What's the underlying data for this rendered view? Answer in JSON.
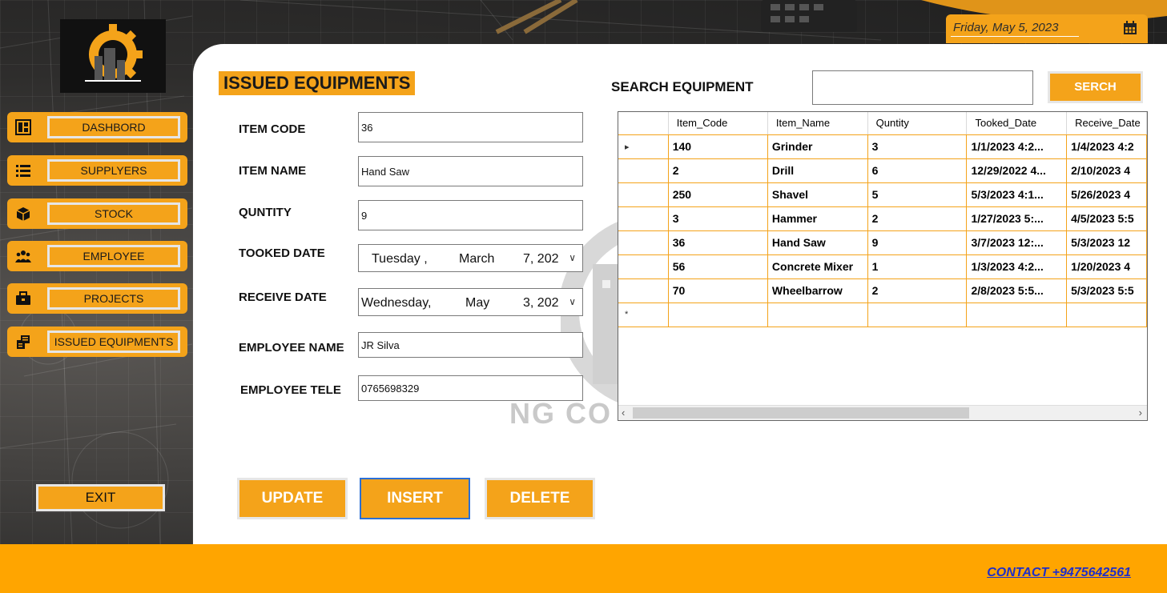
{
  "header": {
    "date": "Friday, May 5, 2023",
    "calendar_icon": "calendar-icon"
  },
  "sidebar": {
    "items": [
      {
        "label": "DASHBORD",
        "icon": "dashboard-icon"
      },
      {
        "label": "SUPPLYERS",
        "icon": "list-icon"
      },
      {
        "label": "STOCK",
        "icon": "boxes-icon"
      },
      {
        "label": "EMPLOYEE",
        "icon": "users-icon"
      },
      {
        "label": "PROJECTS",
        "icon": "briefcase-icon"
      },
      {
        "label": "ISSUED EQUIPMENTS",
        "icon": "equipment-icon"
      }
    ],
    "exit_label": "EXIT"
  },
  "form": {
    "title": "ISSUED EQUIPMENTS",
    "item_code_label": "ITEM CODE",
    "item_code_value": "36",
    "item_name_label": "ITEM NAME",
    "item_name_value": "Hand Saw",
    "quantity_label": "QUNTITY",
    "quantity_value": "9",
    "tooked_date_label": "TOOKED DATE",
    "tooked_date": {
      "day": "Tuesday  ,",
      "month": "March",
      "num": "7, 202"
    },
    "receive_date_label": "RECEIVE DATE",
    "receive_date": {
      "day": "Wednesday,",
      "month": "May",
      "num": "3, 202"
    },
    "employee_name_label": "EMPLOYEE NAME",
    "employee_name_value": "JR Silva",
    "employee_tele_label": "EMPLOYEE TELE",
    "employee_tele_value": "0765698329"
  },
  "search": {
    "label": "SEARCH EQUIPMENT",
    "value": "",
    "button_label": "SERCH"
  },
  "table": {
    "columns": [
      "Item_Code",
      "Item_Name",
      "Quntity",
      "Tooked_Date",
      "Receive_Date"
    ],
    "rows": [
      [
        "140",
        "Grinder",
        "3",
        "1/1/2023 4:2...",
        "1/4/2023 4:2"
      ],
      [
        "2",
        "Drill",
        "6",
        "12/29/2022 4...",
        "2/10/2023 4"
      ],
      [
        "250",
        "Shavel",
        "5",
        "5/3/2023 4:1...",
        "5/26/2023 4"
      ],
      [
        "3",
        "Hammer",
        "2",
        "1/27/2023 5:...",
        "4/5/2023 5:5"
      ],
      [
        "36",
        "Hand Saw",
        "9",
        "3/7/2023 12:...",
        "5/3/2023 12"
      ],
      [
        "56",
        "Concrete Mixer",
        "1",
        "1/3/2023 4:2...",
        "1/20/2023 4"
      ],
      [
        "70",
        "Wheelbarrow",
        "2",
        "2/8/2023 5:5...",
        "5/3/2023 5:5"
      ]
    ],
    "current_row_marker": "▸",
    "new_row_marker": "*"
  },
  "actions": {
    "update_label": "UPDATE",
    "insert_label": "INSERT",
    "delete_label": "DELETE"
  },
  "footer": {
    "contact": "CONTACT +9475642561"
  },
  "watermark": {
    "text": "NG CO"
  },
  "colors": {
    "accent": "#f4a31a",
    "footer": "#ffa500",
    "contact_link": "#1f2fc9"
  }
}
